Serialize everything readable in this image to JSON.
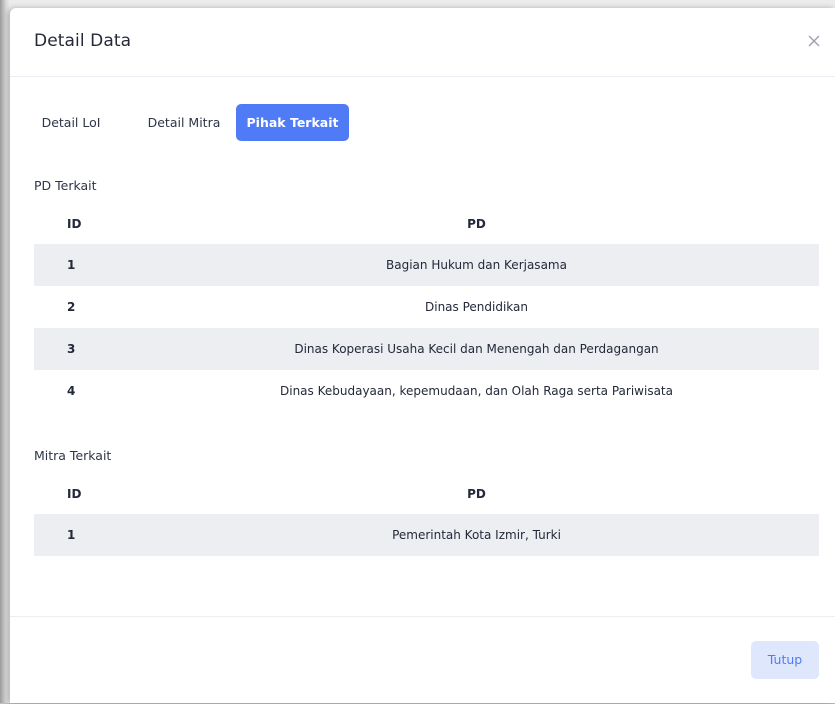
{
  "modal": {
    "title": "Detail Data",
    "tabs": [
      {
        "label": "Detail LoI",
        "active": false
      },
      {
        "label": "Detail Mitra",
        "active": false
      },
      {
        "label": "Pihak Terkait",
        "active": true
      }
    ],
    "pd_section": {
      "label": "PD Terkait",
      "columns": [
        "ID",
        "PD"
      ],
      "rows": [
        {
          "id": "1",
          "pd": "Bagian Hukum dan Kerjasama"
        },
        {
          "id": "2",
          "pd": "Dinas Pendidikan"
        },
        {
          "id": "3",
          "pd": "Dinas Koperasi Usaha Kecil dan Menengah dan Perdagangan"
        },
        {
          "id": "4",
          "pd": "Dinas Kebudayaan, kepemudaan, dan Olah Raga serta Pariwisata"
        }
      ]
    },
    "mitra_section": {
      "label": "Mitra Terkait",
      "columns": [
        "ID",
        "PD"
      ],
      "rows": [
        {
          "id": "1",
          "pd": "Pemerintah Kota Izmir, Turki"
        }
      ]
    },
    "footer": {
      "close_label": "Tutup"
    }
  },
  "colors": {
    "accent": "#4f7cf6",
    "accent_light": "#dfe7fd",
    "stripe": "#eceef2",
    "text": "#232939"
  },
  "icons": {
    "close": "close-icon"
  }
}
